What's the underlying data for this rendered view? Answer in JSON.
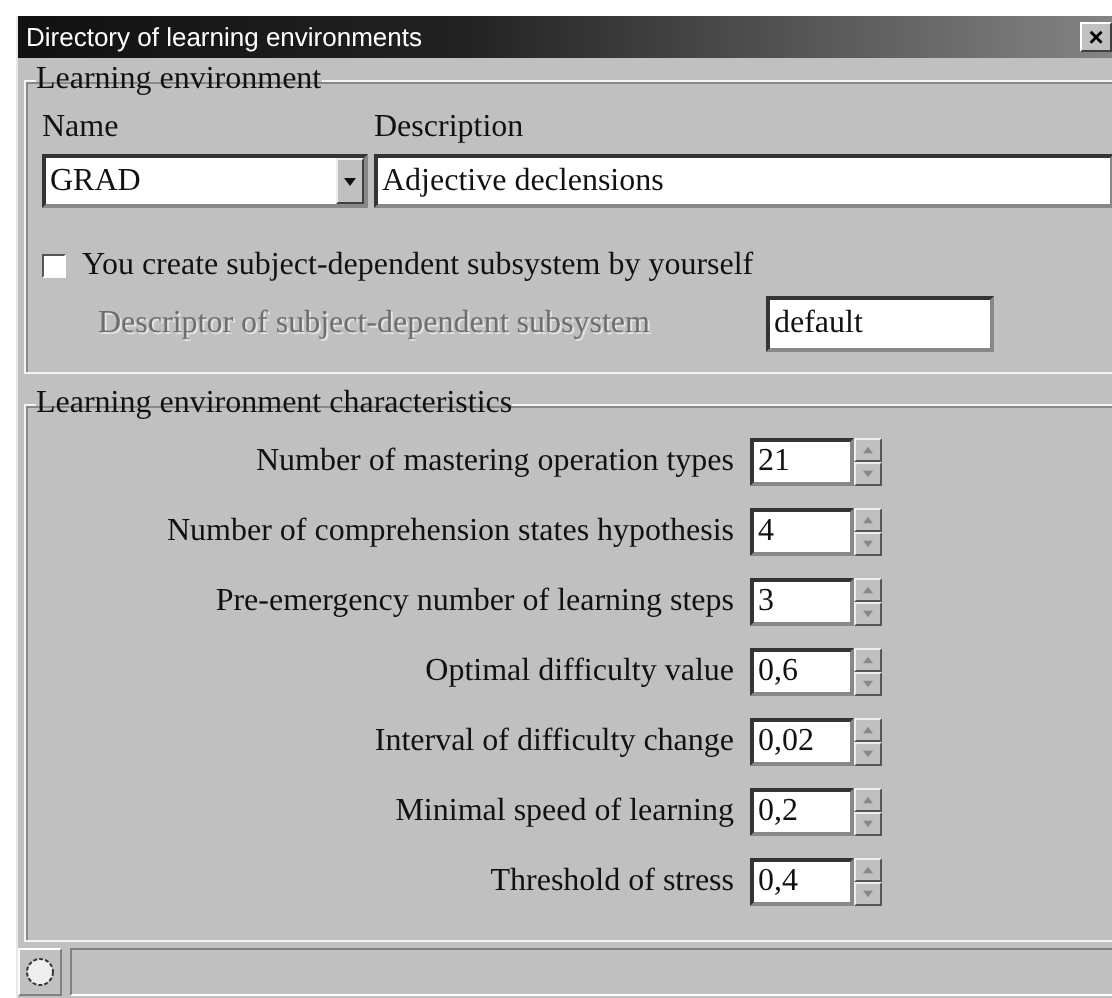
{
  "window": {
    "title": "Directory of learning environments",
    "close": "×"
  },
  "environment": {
    "title": "Learning environment",
    "name_label": "Name",
    "name_value": "GRAD",
    "description_label": "Description",
    "description_value": "Adjective declensions",
    "own_subsystem": {
      "label": "You create subject-dependent subsystem by yourself",
      "checked": false
    },
    "descriptor": {
      "label": "Descriptor of subject-dependent subsystem",
      "value": "default",
      "disabled": true
    }
  },
  "characteristics": {
    "title": "Learning environment characteristics",
    "rows": [
      {
        "label": "Number of mastering operation types",
        "value": "21"
      },
      {
        "label": "Number of comprehension states hypothesis",
        "value": "4"
      },
      {
        "label": "Pre-emergency number of learning steps",
        "value": "3"
      },
      {
        "label": "Optimal difficulty value",
        "value": "0,6"
      },
      {
        "label": "Interval of difficulty change",
        "value": "0,02"
      },
      {
        "label": "Minimal speed of learning",
        "value": "0,2"
      },
      {
        "label": "Threshold of stress",
        "value": "0,4"
      }
    ]
  }
}
